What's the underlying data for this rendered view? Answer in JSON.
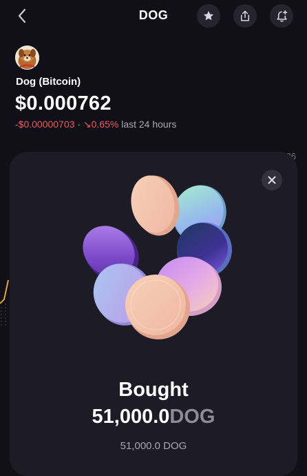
{
  "header": {
    "title": "DOG",
    "icons": [
      "back-chevron-icon",
      "star-icon",
      "share-icon",
      "bell-add-icon"
    ]
  },
  "token": {
    "name": "Dog (Bitcoin)",
    "price": "$0.000762",
    "change_amount": "-$0.00000703",
    "separator": "·",
    "change_arrow": "↘",
    "change_percent": "0.65%",
    "change_period": "last 24 hours"
  },
  "chart_edge_label": "26",
  "sheet": {
    "title": "Bought",
    "amount_value": "51,000.0",
    "amount_ticker": "DOG",
    "sub_amount": "51,000.0 DOG"
  },
  "colors": {
    "background": "#111019",
    "sheet": "#1d1b25",
    "negative": "#ea5b5b",
    "muted": "#8f8c98"
  }
}
